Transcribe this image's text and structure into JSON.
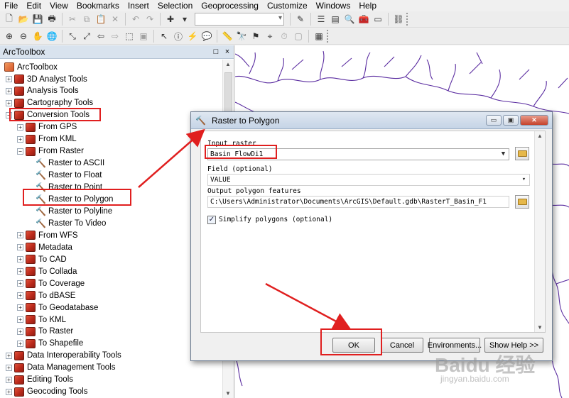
{
  "menu": [
    "File",
    "Edit",
    "View",
    "Bookmarks",
    "Insert",
    "Selection",
    "Geoprocessing",
    "Customize",
    "Windows",
    "Help"
  ],
  "toolbox": {
    "title": "ArcToolbox",
    "pin": "□",
    "close": "×",
    "root": "ArcToolbox",
    "items": [
      {
        "label": "3D Analyst Tools",
        "expander": "+"
      },
      {
        "label": "Analysis Tools",
        "expander": "+"
      },
      {
        "label": "Cartography Tools",
        "expander": "+"
      },
      {
        "label": "Conversion Tools",
        "expander": "−"
      },
      {
        "label": "From GPS",
        "expander": "+"
      },
      {
        "label": "From KML",
        "expander": "+"
      },
      {
        "label": "From Raster",
        "expander": "−"
      },
      {
        "label": "Raster to ASCII"
      },
      {
        "label": "Raster to Float"
      },
      {
        "label": "Raster to Point"
      },
      {
        "label": "Raster to Polygon"
      },
      {
        "label": "Raster to Polyline"
      },
      {
        "label": "Raster To Video"
      },
      {
        "label": "From WFS",
        "expander": "+"
      },
      {
        "label": "Metadata",
        "expander": "+"
      },
      {
        "label": "To CAD",
        "expander": "+"
      },
      {
        "label": "To Collada",
        "expander": "+"
      },
      {
        "label": "To Coverage",
        "expander": "+"
      },
      {
        "label": "To dBASE",
        "expander": "+"
      },
      {
        "label": "To Geodatabase",
        "expander": "+"
      },
      {
        "label": "To KML",
        "expander": "+"
      },
      {
        "label": "To Raster",
        "expander": "+"
      },
      {
        "label": "To Shapefile",
        "expander": "+"
      },
      {
        "label": "Data Interoperability Tools",
        "expander": "+"
      },
      {
        "label": "Data Management Tools",
        "expander": "+"
      },
      {
        "label": "Editing Tools",
        "expander": "+"
      },
      {
        "label": "Geocoding Tools",
        "expander": "+"
      }
    ]
  },
  "dialog": {
    "title": "Raster to Polygon",
    "min": "▭",
    "max": "▣",
    "close": "✕",
    "input_raster_label": "Input raster",
    "input_raster_value": "Basin_FlowDi1",
    "field_label": "Field (optional)",
    "field_value": "VALUE",
    "output_label": "Output polygon features",
    "output_value": "C:\\Users\\Administrator\\Documents\\ArcGIS\\Default.gdb\\RasterT_Basin_F1",
    "simplify_label": "Simplify polygons (optional)",
    "simplify_checked": "✓",
    "ok": "OK",
    "cancel": "Cancel",
    "environments": "Environments...",
    "show_help": "Show Help >>"
  },
  "watermark": {
    "brand": "Baidu 经验",
    "url": "jingyan.baidu.com"
  },
  "colors": {
    "annotation_red": "#e01f1f",
    "river_purple": "#5a2ca0"
  }
}
